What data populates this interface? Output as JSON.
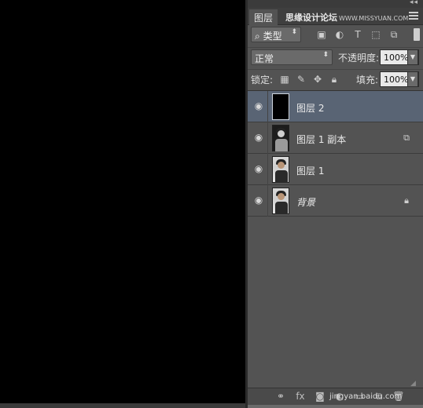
{
  "panel": {
    "tab_label": "图层",
    "watermark": "思缘设计论坛",
    "watermark_url": "WWW.MISSYUAN.COM"
  },
  "filter": {
    "kind_label": "类型",
    "icons": [
      "image-filter-icon",
      "adjustment-filter-icon",
      "type-filter-icon",
      "shape-filter-icon",
      "smart-object-filter-icon"
    ]
  },
  "blend": {
    "mode": "正常",
    "opacity_label": "不透明度:",
    "opacity_value": "100%"
  },
  "lock": {
    "label": "锁定:",
    "fill_label": "填充:",
    "fill_value": "100%"
  },
  "layers": [
    {
      "name": "图层 2",
      "selected": true
    },
    {
      "name": "图层 1 副本",
      "selected": false
    },
    {
      "name": "图层 1",
      "selected": false
    },
    {
      "name": "背景",
      "selected": false
    }
  ],
  "footer": {
    "watermark": "jingyan.baidu.com"
  },
  "colors": {
    "canvas": "#000000",
    "panel_bg": "#535353",
    "selected_layer": "#596474"
  }
}
